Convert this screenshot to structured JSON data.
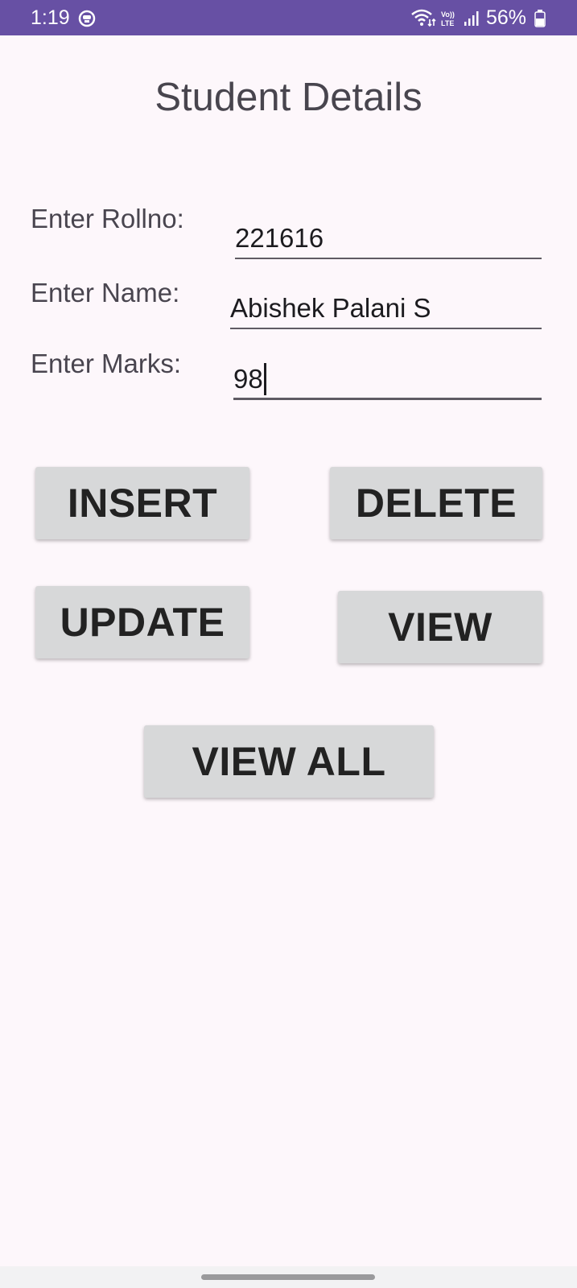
{
  "status_bar": {
    "time": "1:19",
    "battery_percent": "56%",
    "color": "#6750a4",
    "icons": [
      "app-notification-icon",
      "wifi-icon",
      "volte-icon",
      "signal-icon",
      "battery-icon"
    ]
  },
  "page": {
    "title": "Student Details"
  },
  "form": {
    "rollno": {
      "label": "Enter Rollno:",
      "value": "221616"
    },
    "name": {
      "label": "Enter Name:",
      "value": "Abishek Palani S"
    },
    "marks": {
      "label": "Enter Marks:",
      "value": "98"
    }
  },
  "buttons": {
    "insert": "INSERT",
    "delete": "DELETE",
    "update": "UPDATE",
    "view": "VIEW",
    "view_all": "VIEW ALL",
    "color": "#d7d8d9"
  }
}
